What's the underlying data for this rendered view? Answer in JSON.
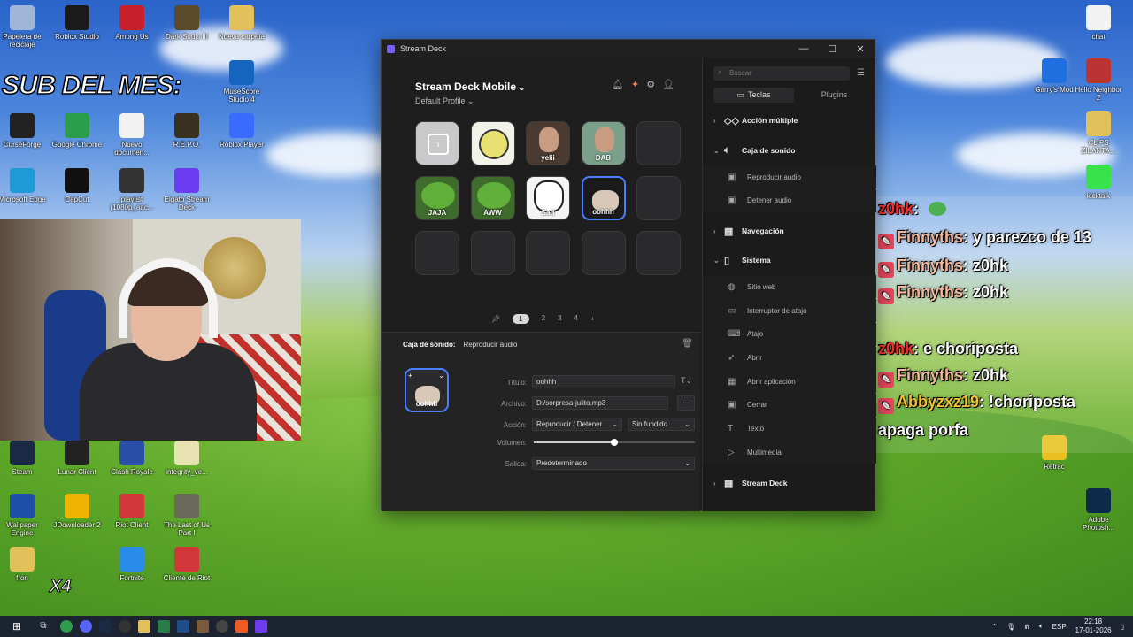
{
  "overlay": {
    "sub_del_mes": "SUB DEL MES:"
  },
  "desktop": {
    "icons_left": [
      {
        "label": "Papelera de reciclaje",
        "icon": "recycle-bin-icon",
        "color": "#9fb6d6"
      },
      {
        "label": "Roblox Studio",
        "icon": "roblox-studio-icon",
        "color": "#1a1a1a"
      },
      {
        "label": "Among Us",
        "icon": "among-us-icon",
        "color": "#c7202b"
      },
      {
        "label": "Dark Souls III",
        "icon": "dark-souls-icon",
        "color": "#5b4a2a"
      },
      {
        "label": "Nueva carpeta",
        "icon": "folder-icon",
        "color": "#e2c05a"
      },
      {
        "label": "MuseScore Studio 4",
        "icon": "musescore-icon",
        "color": "#1565c0"
      },
      {
        "label": "CurseForge",
        "icon": "curseforge-icon",
        "color": "#222"
      },
      {
        "label": "Google Chrome",
        "icon": "chrome-icon",
        "color": "#2c9d4b"
      },
      {
        "label": "Nuevo documen...",
        "icon": "document-icon",
        "color": "#f2f2f2"
      },
      {
        "label": "R.E.P.O.",
        "icon": "repo-icon",
        "color": "#3a3020"
      },
      {
        "label": "Roblox Player",
        "icon": "roblox-icon",
        "color": "#3a6bff"
      },
      {
        "label": "Microsoft Edge",
        "icon": "edge-icon",
        "color": "#1e9ad6"
      },
      {
        "label": "CapCut",
        "icon": "capcut-icon",
        "color": "#111"
      },
      {
        "label": "playlist (1080p_aac...",
        "icon": "video-file-icon",
        "color": "#333"
      },
      {
        "label": "Elgato Stream Deck",
        "icon": "stream-deck-icon",
        "color": "#6b3cf0"
      },
      {
        "label": "Steam",
        "icon": "steam-icon",
        "color": "#1b2a44"
      },
      {
        "label": "Lunar Client",
        "icon": "lunar-client-icon",
        "color": "#222"
      },
      {
        "label": "Clash Royale",
        "icon": "clash-royale-icon",
        "color": "#2a4fa8"
      },
      {
        "label": "integrity_ve...",
        "icon": "file-icon",
        "color": "#e9e3b4"
      },
      {
        "label": "Wallpaper Engine",
        "icon": "wallpaper-engine-icon",
        "color": "#1e4ea8"
      },
      {
        "label": "JDownloader 2",
        "icon": "jdownloader-icon",
        "color": "#f0b400"
      },
      {
        "label": "Riot Client",
        "icon": "riot-client-icon",
        "color": "#d13639"
      },
      {
        "label": "The Last of Us Part I",
        "icon": "tlou-icon",
        "color": "#6a6a5a"
      },
      {
        "label": "fron",
        "icon": "folder-icon",
        "color": "#e2c05a"
      },
      {
        "label": "Fortnite",
        "icon": "fortnite-icon",
        "color": "#2a8ce8"
      },
      {
        "label": "Cliente de Riot",
        "icon": "riot-client-icon",
        "color": "#d13639"
      }
    ],
    "icons_right": [
      {
        "label": "chat",
        "icon": "document-icon",
        "color": "#f2f2f2"
      },
      {
        "label": "Garry's Mod",
        "icon": "gmod-icon",
        "color": "#1f6fe0"
      },
      {
        "label": "Hello Neighbor 2",
        "icon": "hello-neighbor-icon",
        "color": "#b33"
      },
      {
        "label": "CLIPS ZILANTA...",
        "icon": "folder-icon",
        "color": "#e2c05a"
      },
      {
        "label": "kicktalk",
        "icon": "kicktalk-icon",
        "color": "#37e24a"
      },
      {
        "label": "Retrac",
        "icon": "retrac-icon",
        "color": "#e8c020"
      },
      {
        "label": "Adobe Photosh...",
        "icon": "photoshop-icon",
        "color": "#0d2a4a"
      }
    ],
    "x4_label": "X4"
  },
  "chat": {
    "lines": [
      {
        "user": "z0hk",
        "text": "",
        "user_color": "#ff2d2d",
        "badge": false
      },
      {
        "user": "Finnyths",
        "text": "y parezco de 13",
        "user_color": "#f2b8a0",
        "badge": true
      },
      {
        "user": "Finnyths",
        "text": "z0hk",
        "user_color": "#f2b8a0",
        "badge": true
      },
      {
        "user": "Finnyths",
        "text": "z0hk",
        "user_color": "#f2b8a0",
        "badge": true
      },
      {
        "user": "z0hk",
        "text": "e choriposta",
        "user_color": "#ff2d2d",
        "badge": false
      },
      {
        "user": "Finnyths",
        "text": "z0hk",
        "user_color": "#f2b8a0",
        "badge": true
      },
      {
        "user": "Abbyzxz19",
        "text": "!choriposta",
        "user_color": "#f0c030",
        "badge": true
      },
      {
        "user": "",
        "text": "apaga porfa",
        "user_color": "#fff",
        "badge": false
      }
    ]
  },
  "window": {
    "title": "Stream Deck",
    "minimize": "—",
    "maximize": "☐",
    "close": "✕"
  },
  "profile": {
    "device": "Stream Deck Mobile",
    "profile_name": "Default Profile"
  },
  "keys": [
    {
      "label": "",
      "kind": "folder"
    },
    {
      "label": "",
      "kind": "meme-face"
    },
    {
      "label": "yelii",
      "kind": "photo"
    },
    {
      "label": "DAB",
      "kind": "photo"
    },
    {
      "label": "",
      "kind": "empty"
    },
    {
      "label": "JAJA",
      "kind": "pepe"
    },
    {
      "label": "AWW",
      "kind": "pepe"
    },
    {
      "label": "Sad",
      "kind": "troll"
    },
    {
      "label": "oohhh",
      "kind": "selected"
    },
    {
      "label": "",
      "kind": "empty"
    },
    {
      "label": "",
      "kind": "empty"
    },
    {
      "label": "",
      "kind": "empty"
    },
    {
      "label": "",
      "kind": "empty"
    },
    {
      "label": "",
      "kind": "empty"
    },
    {
      "label": "",
      "kind": "empty"
    }
  ],
  "pager": {
    "pages": [
      "1",
      "2",
      "3",
      "4"
    ],
    "current": "1",
    "add": "+"
  },
  "editor": {
    "category": "Caja de sonido:",
    "action": "Reproducir audio",
    "preview_label": "oohhh",
    "title_label": "Título:",
    "title_value": "oohhh",
    "file_label": "Archivo:",
    "file_value": "D:/sorpresa-julito.mp3",
    "browse": "...",
    "action_label": "Acción:",
    "action_value": "Reproducir / Detener",
    "fade_value": "Sin fundido",
    "volume_label": "Volumen:",
    "volume_fraction": 0.5,
    "output_label": "Salida:",
    "output_value": "Predeterminado"
  },
  "sidebar": {
    "search_placeholder": "Buscar",
    "tabs": [
      "Teclas",
      "Plugins"
    ],
    "categories": [
      {
        "label": "Acción múltiple",
        "expanded": false,
        "items": []
      },
      {
        "label": "Caja de sonido",
        "expanded": true,
        "items": [
          "Reproducir audio",
          "Detener audio"
        ]
      },
      {
        "label": "Navegación",
        "expanded": false,
        "items": []
      },
      {
        "label": "Sistema",
        "expanded": true,
        "items": [
          "Sitio web",
          "Interruptor de atajo",
          "Atajo",
          "Abrir",
          "Abrir aplicación",
          "Cerrar",
          "Texto",
          "Multimedia"
        ]
      },
      {
        "label": "Stream Deck",
        "expanded": false,
        "items": []
      }
    ]
  },
  "taskbar": {
    "language": "ESP",
    "time": "22:18",
    "date": "17-01-2026"
  }
}
